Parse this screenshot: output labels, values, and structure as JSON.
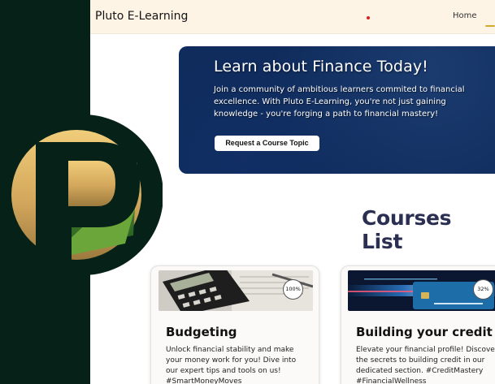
{
  "app": {
    "brand": "Pluto E-Learning"
  },
  "nav": {
    "home_label": "Home"
  },
  "hero": {
    "title": "Learn about Finance Today!",
    "text": "Join a community of ambitious learners commited to financial excellence. With Pluto E-Learning, you're not just gaining knowledge - you're forging a path to financial mastery!",
    "button_label": "Request a Course Topic"
  },
  "courses": {
    "title": "Courses List",
    "items": [
      {
        "title": "Budgeting",
        "progress": "100%",
        "progress_value": 100,
        "description": "Unlock financial stability and make your money work for you! Dive into our expert tips and tools on us! #SmartMoneyMoves"
      },
      {
        "title": "Building your credit",
        "progress": "32%",
        "progress_value": 32,
        "description": "Elevate your financial profile! Discover the secrets to building credit in our dedicated section. #CreditMastery #FinancialWellness"
      }
    ]
  },
  "colors": {
    "sidebar": "#062218",
    "topbar": "#fdf4e6",
    "hero": "#0f2b5b",
    "heading": "#2b3053",
    "gold": "#d4a92c",
    "green": "#6aa63a"
  },
  "icons": {
    "logo": "pluto-p-logo",
    "card_1_image": "calculator-photo",
    "card_2_image": "credit-card-photo"
  }
}
